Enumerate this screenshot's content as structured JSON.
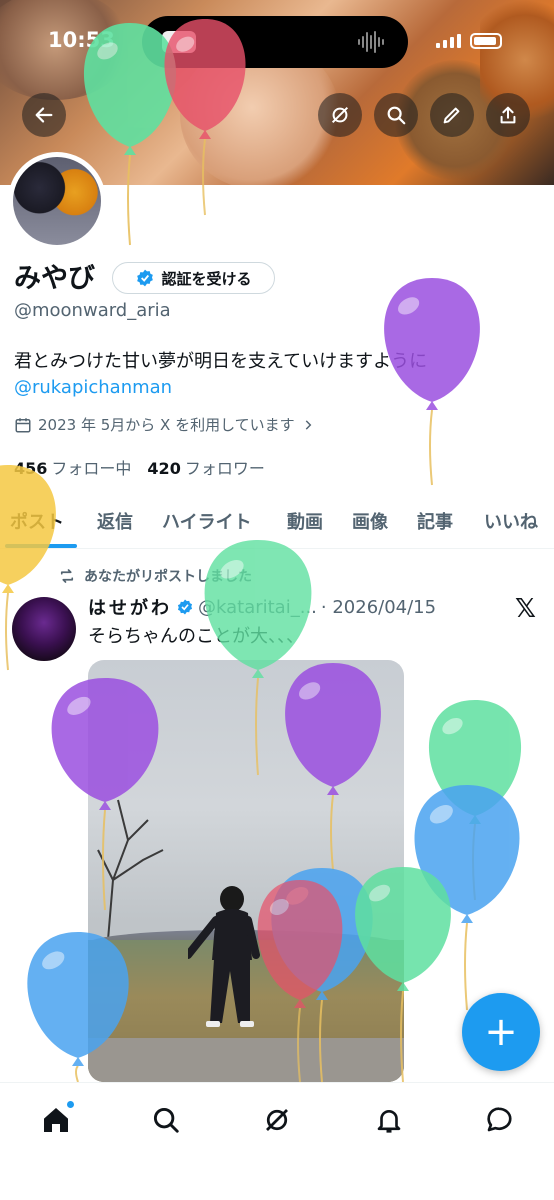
{
  "status_bar": {
    "time": "10:53"
  },
  "profile": {
    "name": "みやび",
    "verify_button": "認証を受ける",
    "handle": "@moonward_aria",
    "bio": "君とみつけた甘い夢が明日を支えていけますように",
    "bio_mention": "@rukapichanman",
    "joined": "2023 年 5月から X を利用しています",
    "following_count": "456",
    "following_label": "フォロー中",
    "followers_count": "420",
    "followers_label": "フォロワー"
  },
  "header_buttons": [
    "back-arrow-icon",
    "grok-icon",
    "search-icon",
    "edit-icon",
    "share-icon"
  ],
  "tabs": [
    "ポスト",
    "返信",
    "ハイライト",
    "動画",
    "画像",
    "記事",
    "いいね"
  ],
  "post": {
    "repost_label": "あなたがリポストしました",
    "author_name": "はせがわ",
    "author_handle": "@kataritai_...",
    "date": "· 2026/04/15",
    "text": "そらちゃんのことが大、、、",
    "platform_logo": "𝕏"
  },
  "fab_label": "+",
  "bottom_nav": [
    "home-icon",
    "search-icon",
    "grok-icon",
    "notifications-icon",
    "messages-icon"
  ],
  "colors": {
    "accent": "#1d9bf0",
    "balloon_green": "#5fe0a0",
    "balloon_purple": "#9b4fe0",
    "balloon_blue": "#4aa3f0",
    "balloon_red": "#e8506a",
    "balloon_yellow": "#f5c842"
  }
}
